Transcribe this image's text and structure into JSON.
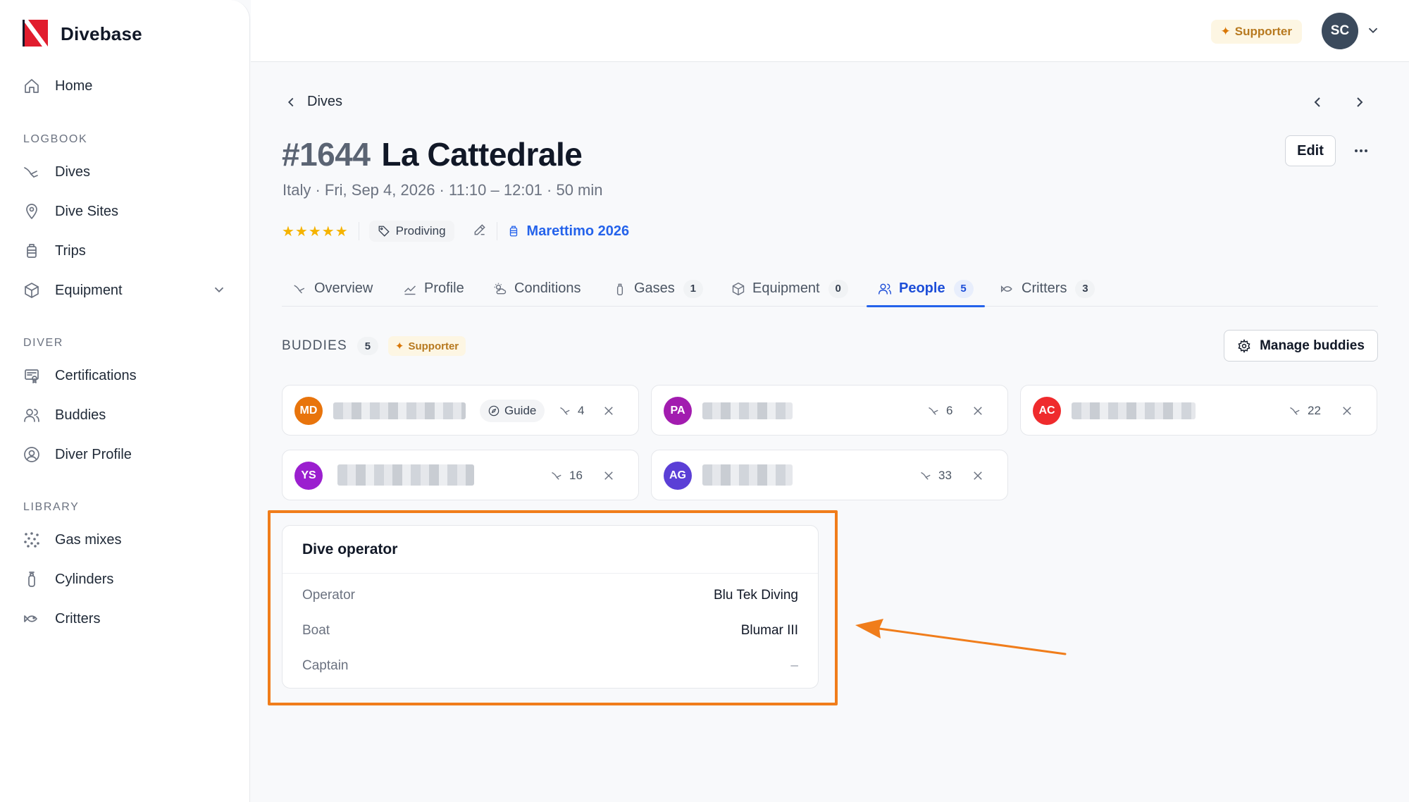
{
  "brand": {
    "name": "Divebase"
  },
  "sidebar": {
    "home": "Home",
    "sections": {
      "logbook": "LOGBOOK",
      "diver": "DIVER",
      "library": "LIBRARY"
    },
    "logbook_items": [
      "Dives",
      "Dive Sites",
      "Trips",
      "Equipment"
    ],
    "diver_items": [
      "Certifications",
      "Buddies",
      "Diver Profile"
    ],
    "library_items": [
      "Gas mixes",
      "Cylinders",
      "Critters"
    ]
  },
  "header": {
    "supporter_label": "Supporter",
    "avatar_initials": "SC"
  },
  "dive": {
    "back_label": "Dives",
    "number": "#1644",
    "name": "La Cattedrale",
    "subtitle": "Italy · Fri, Sep 4, 2026 · 11:10 – 12:01 · 50 min",
    "rating_stars": "★★★★★",
    "rating": 5,
    "tag": "Prodiving",
    "trip": "Marettimo 2026",
    "edit_label": "Edit"
  },
  "tabs": [
    {
      "label": "Overview",
      "icon": "dive-icon"
    },
    {
      "label": "Profile",
      "icon": "chart-icon"
    },
    {
      "label": "Conditions",
      "icon": "weather-icon"
    },
    {
      "label": "Gases",
      "icon": "cylinder-icon",
      "count": "1"
    },
    {
      "label": "Equipment",
      "icon": "box-icon",
      "count": "0"
    },
    {
      "label": "People",
      "icon": "people-icon",
      "count": "5",
      "active": true
    },
    {
      "label": "Critters",
      "icon": "fish-icon",
      "count": "3"
    }
  ],
  "buddies": {
    "title": "BUDDIES",
    "count": "5",
    "supporter_label": "Supporter",
    "manage_label": "Manage buddies",
    "list": [
      {
        "initials": "MD",
        "color": "#e8740c",
        "role": "Guide",
        "dives": "4"
      },
      {
        "initials": "PA",
        "color": "#a21caf",
        "dives": "6"
      },
      {
        "initials": "AC",
        "color": "#ef2b2d",
        "dives": "22"
      },
      {
        "initials": "YS",
        "color": "#9b1fcf",
        "dives": "16"
      },
      {
        "initials": "AG",
        "color": "#5b3fd6",
        "dives": "33"
      }
    ]
  },
  "operator": {
    "title": "Dive operator",
    "rows": [
      {
        "label": "Operator",
        "value": "Blu Tek Diving"
      },
      {
        "label": "Boat",
        "value": "Blumar III"
      },
      {
        "label": "Captain",
        "value": "–"
      }
    ]
  },
  "colors": {
    "accent": "#2563eb",
    "highlight": "#f07d1b",
    "supporter": "#b7791f",
    "stars": "#f5b301"
  }
}
